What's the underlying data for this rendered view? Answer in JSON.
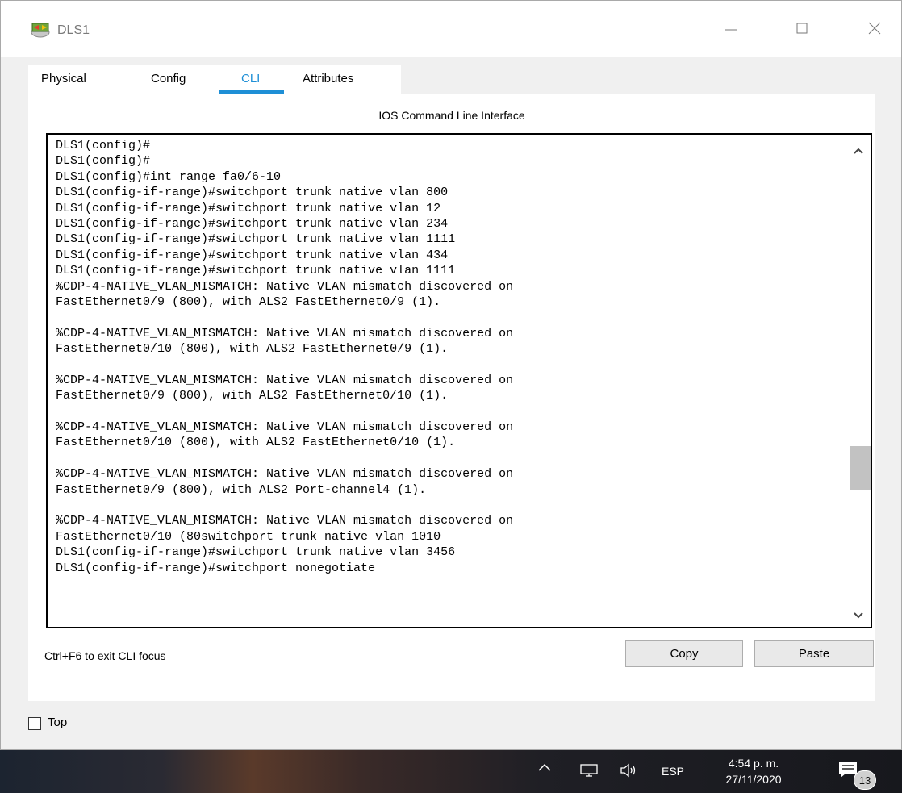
{
  "window": {
    "title": "DLS1",
    "minimize_icon": "minimize-icon",
    "maximize_icon": "maximize-icon",
    "close_icon": "close-icon"
  },
  "tabs": [
    {
      "label": "Physical",
      "active": false
    },
    {
      "label": "Config",
      "active": false
    },
    {
      "label": "CLI",
      "active": true
    },
    {
      "label": "Attributes",
      "active": false
    }
  ],
  "cli": {
    "heading": "IOS Command Line Interface",
    "lines": [
      "DLS1(config)#",
      "DLS1(config)#",
      "DLS1(config)#int range fa0/6-10",
      "DLS1(config-if-range)#switchport trunk native vlan 800",
      "DLS1(config-if-range)#switchport trunk native vlan 12",
      "DLS1(config-if-range)#switchport trunk native vlan 234",
      "DLS1(config-if-range)#switchport trunk native vlan 1111",
      "DLS1(config-if-range)#switchport trunk native vlan 434",
      "DLS1(config-if-range)#switchport trunk native vlan 1111",
      "%CDP-4-NATIVE_VLAN_MISMATCH: Native VLAN mismatch discovered on",
      "FastEthernet0/9 (800), with ALS2 FastEthernet0/9 (1).",
      "",
      "%CDP-4-NATIVE_VLAN_MISMATCH: Native VLAN mismatch discovered on",
      "FastEthernet0/10 (800), with ALS2 FastEthernet0/9 (1).",
      "",
      "%CDP-4-NATIVE_VLAN_MISMATCH: Native VLAN mismatch discovered on",
      "FastEthernet0/9 (800), with ALS2 FastEthernet0/10 (1).",
      "",
      "%CDP-4-NATIVE_VLAN_MISMATCH: Native VLAN mismatch discovered on",
      "FastEthernet0/10 (800), with ALS2 FastEthernet0/10 (1).",
      "",
      "%CDP-4-NATIVE_VLAN_MISMATCH: Native VLAN mismatch discovered on",
      "FastEthernet0/9 (800), with ALS2 Port-channel4 (1).",
      "",
      "%CDP-4-NATIVE_VLAN_MISMATCH: Native VLAN mismatch discovered on",
      "FastEthernet0/10 (80switchport trunk native vlan 1010",
      "DLS1(config-if-range)#switchport trunk native vlan 3456",
      "DLS1(config-if-range)#switchport nonegotiate"
    ],
    "exit_hint": "Ctrl+F6 to exit CLI focus",
    "copy_label": "Copy",
    "paste_label": "Paste"
  },
  "footer": {
    "top_label": "Top",
    "top_checked": false
  },
  "taskbar": {
    "language": "ESP",
    "time": "4:54 p. m.",
    "date": "27/11/2020",
    "notification_count": "13"
  }
}
